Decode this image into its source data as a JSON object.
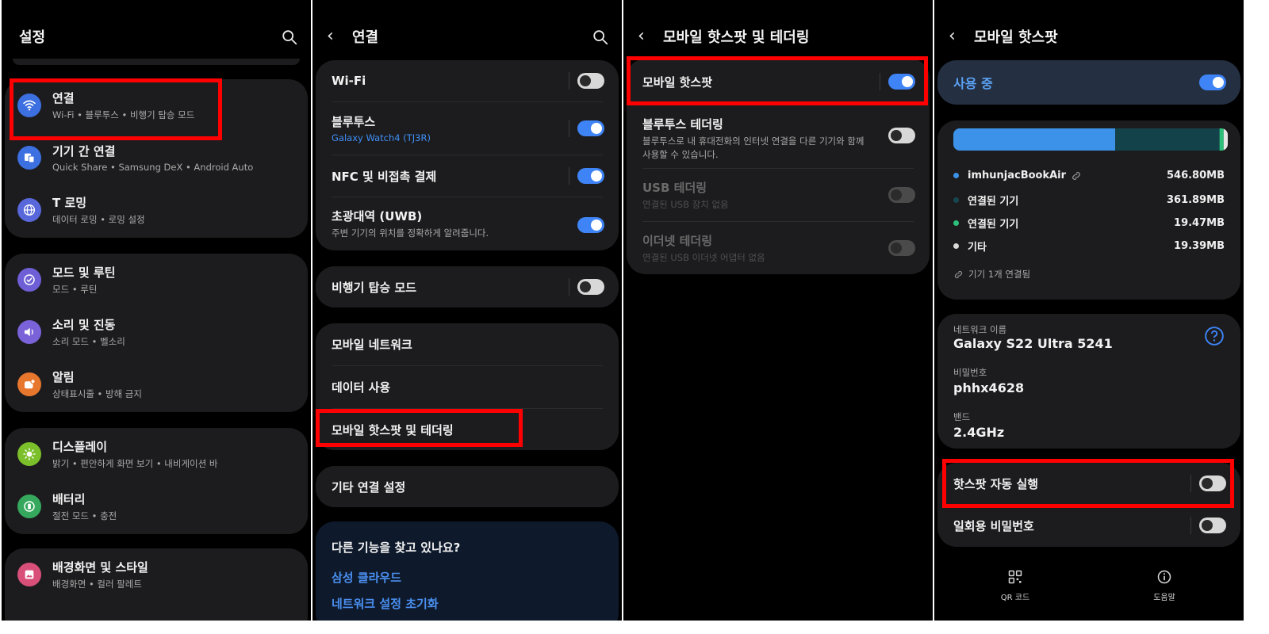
{
  "panel1": {
    "title": "설정",
    "groups": [
      [
        {
          "label": "연결",
          "sub": "Wi-Fi • 블루투스 • 비행기 탑승 모드",
          "icon": "wifi-icon",
          "color": "#3c6fe0"
        },
        {
          "label": "기기 간 연결",
          "sub": "Quick Share • Samsung DeX • Android Auto",
          "icon": "devices-icon",
          "color": "#3c6fe0"
        },
        {
          "label": "T 로밍",
          "sub": "데이터 로밍 • 로밍 설정",
          "icon": "globe-icon",
          "color": "#5867d9"
        }
      ],
      [
        {
          "label": "모드 및 루틴",
          "sub": "모드 • 루틴",
          "icon": "check-circle-icon",
          "color": "#6e5fd6"
        },
        {
          "label": "소리 및 진동",
          "sub": "소리 모드 • 벨소리",
          "icon": "speaker-icon",
          "color": "#7a62d8"
        },
        {
          "label": "알림",
          "sub": "상태표시줄 • 방해 금지",
          "icon": "notification-icon",
          "color": "#e8772e"
        }
      ],
      [
        {
          "label": "디스플레이",
          "sub": "밝기 • 편안하게 화면 보기 • 내비게이션 바",
          "icon": "sun-icon",
          "color": "#7bbf2a"
        },
        {
          "label": "배터리",
          "sub": "절전 모드 • 충전",
          "icon": "battery-icon",
          "color": "#35a85d"
        }
      ],
      [
        {
          "label": "배경화면 및 스타일",
          "sub": "배경화면 • 컬러 팔레트",
          "icon": "wallpaper-icon",
          "color": "#d8507a"
        }
      ]
    ]
  },
  "panel2": {
    "title": "연결",
    "card1": [
      {
        "label": "Wi-Fi",
        "sub": "",
        "toggle": false
      },
      {
        "label": "블루투스",
        "sub": "Galaxy Watch4 (TJ3R)",
        "toggle": true
      },
      {
        "label": "NFC 및 비접촉 결제",
        "sub": "",
        "toggle": true
      },
      {
        "label": "초광대역 (UWB)",
        "sub": "주변 기기의 위치를 정확하게 알려줍니다.",
        "toggle": true
      }
    ],
    "airplane": {
      "label": "비행기 탑승 모드",
      "toggle": false
    },
    "card3": [
      "모바일 네트워크",
      "데이터 사용",
      "모바일 핫스팟 및 테더링"
    ],
    "other": "기타 연결 설정",
    "suggest": {
      "title": "다른 기능을 찾고 있나요?",
      "links": [
        "삼성 클라우드",
        "네트워크 설정 초기화"
      ]
    }
  },
  "panel3": {
    "title": "모바일 핫스팟 및 테더링",
    "rows": [
      {
        "label": "모바일 핫스팟",
        "sub": "",
        "toggle": true,
        "disabled": false
      },
      {
        "label": "블루투스 테더링",
        "sub": "블루투스로 내 휴대전화의 인터넷 연결을 다른 기기와 함께 사용할 수 있습니다.",
        "toggle": false,
        "disabled": false
      },
      {
        "label": "USB 테더링",
        "sub": "연결된 USB 장치 없음",
        "toggle": false,
        "disabled": true
      },
      {
        "label": "이더넷 테더링",
        "sub": "연결된 USB 이더넷 어댑터 없음",
        "toggle": false,
        "disabled": true
      }
    ]
  },
  "panel4": {
    "title": "모바일 핫스팟",
    "in_use": {
      "label": "사용 중",
      "toggle": true
    },
    "usage_bar": [
      {
        "fraction": 0.59,
        "color": "#3b92e8"
      },
      {
        "fraction": 0.38,
        "color": "#14424a"
      },
      {
        "fraction": 0.015,
        "color": "#2cc07a"
      },
      {
        "fraction": 0.015,
        "color": "#e6e6e6"
      }
    ],
    "usage": [
      {
        "name": "imhunjacBookAir",
        "value": "546.80MB",
        "color": "#3b92e8",
        "link": true
      },
      {
        "name": "연결된 기기",
        "value": "361.89MB",
        "color": "#16464f",
        "link": false
      },
      {
        "name": "연결된 기기",
        "value": "19.47MB",
        "color": "#2cc07a",
        "link": false
      },
      {
        "name": "기타",
        "value": "19.39MB",
        "color": "#d9d9d9",
        "link": false
      }
    ],
    "connected": "기기 1개 연결됨",
    "network_label": "네트워크 이름",
    "network_name": "Galaxy S22 Ultra 5241",
    "password_label": "비밀번호",
    "password": "phhx4628",
    "band_label": "밴드",
    "band": "2.4GHz",
    "auto_label": "핫스팟 자동 실행",
    "otp_label": "일회용 비밀번호",
    "bottom": [
      "QR 코드",
      "도움말"
    ]
  }
}
